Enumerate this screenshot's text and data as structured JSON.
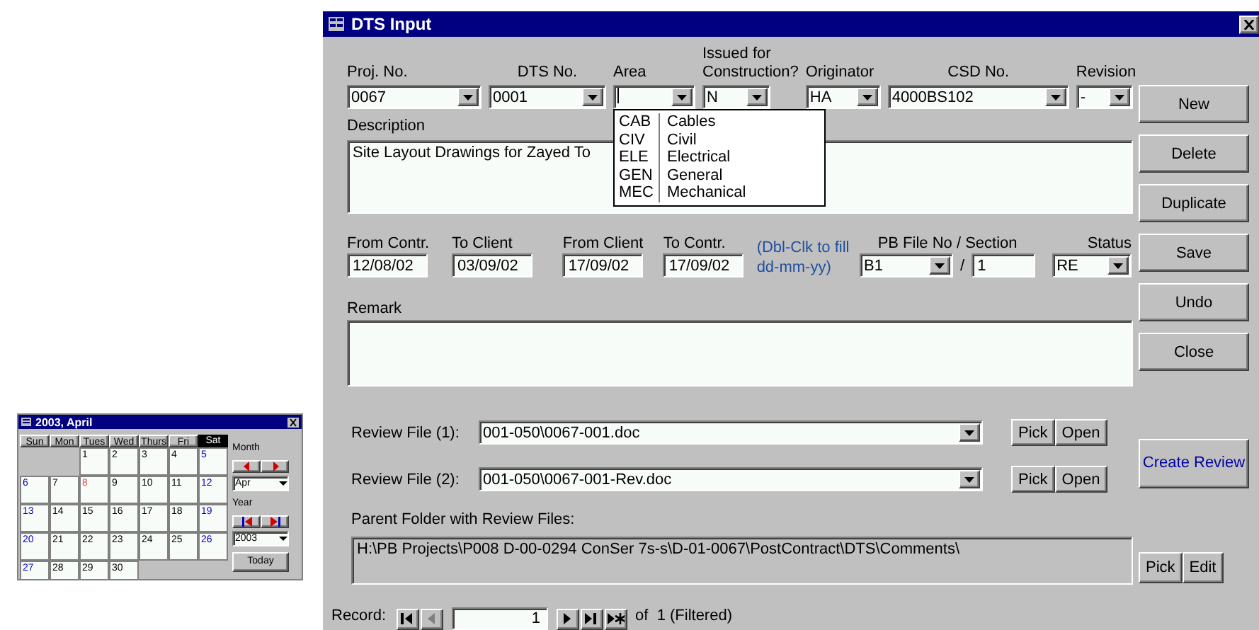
{
  "calendar": {
    "title": "2003, April",
    "days": [
      {
        "label": "Sun",
        "selected": false
      },
      {
        "label": "Mon",
        "selected": false
      },
      {
        "label": "Tues",
        "selected": false
      },
      {
        "label": "Wed",
        "selected": false
      },
      {
        "label": "Thurs",
        "selected": false
      },
      {
        "label": "Fri",
        "selected": false
      },
      {
        "label": "Sat",
        "selected": true
      }
    ],
    "weeks": [
      [
        {
          "kind": "blank"
        },
        {
          "kind": "blank"
        },
        {
          "kind": "weekday",
          "day": "1"
        },
        {
          "kind": "weekday",
          "day": "2"
        },
        {
          "kind": "weekday",
          "day": "3"
        },
        {
          "kind": "weekday",
          "day": "4"
        },
        {
          "kind": "weekend",
          "day": "5"
        }
      ],
      [
        {
          "kind": "weekend",
          "day": "6"
        },
        {
          "kind": "weekday",
          "day": "7"
        },
        {
          "kind": "today",
          "day": "8"
        },
        {
          "kind": "weekday",
          "day": "9"
        },
        {
          "kind": "weekday",
          "day": "10"
        },
        {
          "kind": "weekday",
          "day": "11"
        },
        {
          "kind": "weekend",
          "day": "12"
        }
      ],
      [
        {
          "kind": "weekend",
          "day": "13"
        },
        {
          "kind": "weekday",
          "day": "14"
        },
        {
          "kind": "weekday",
          "day": "15"
        },
        {
          "kind": "weekday",
          "day": "16"
        },
        {
          "kind": "weekday",
          "day": "17"
        },
        {
          "kind": "weekday",
          "day": "18"
        },
        {
          "kind": "weekend",
          "day": "19"
        }
      ],
      [
        {
          "kind": "weekend",
          "day": "20"
        },
        {
          "kind": "weekday",
          "day": "21"
        },
        {
          "kind": "weekday",
          "day": "22"
        },
        {
          "kind": "weekday",
          "day": "23"
        },
        {
          "kind": "weekday",
          "day": "24"
        },
        {
          "kind": "weekday",
          "day": "25"
        },
        {
          "kind": "weekend",
          "day": "26"
        }
      ],
      [
        {
          "kind": "weekend",
          "day": "27"
        },
        {
          "kind": "weekday",
          "day": "28"
        },
        {
          "kind": "weekday",
          "day": "29"
        },
        {
          "kind": "weekday",
          "day": "30"
        },
        {
          "kind": "blank"
        },
        {
          "kind": "blank"
        },
        {
          "kind": "blank"
        }
      ]
    ],
    "month_label": "Month",
    "month": "Apr",
    "year_label": "Year",
    "year": "2003",
    "today_button": "Today"
  },
  "window": {
    "title": "DTS Input"
  },
  "top_fields": [
    {
      "label": "Proj. No.",
      "value": "0067",
      "focused": false
    },
    {
      "label": "DTS No.",
      "value": "0001",
      "focused": false
    },
    {
      "label": "Area",
      "focused": true
    },
    {
      "label": "Issued for Construction?",
      "value": "N",
      "focused": false
    },
    {
      "label": "Originator",
      "value": "HA",
      "focused": false
    },
    {
      "label": "CSD No.",
      "value": "4000BS102",
      "focused": false
    },
    {
      "label": "Revision",
      "value": "-",
      "focused": false
    }
  ],
  "area_dropdown": [
    {
      "code": "CAB",
      "name": "Cables"
    },
    {
      "code": "CIV",
      "name": "Civil"
    },
    {
      "code": "ELE",
      "name": "Electrical"
    },
    {
      "code": "GEN",
      "name": "General"
    },
    {
      "code": "MEC",
      "name": "Mechanical"
    }
  ],
  "description": {
    "label": "Description",
    "value": "Site Layout Drawings for Zayed To"
  },
  "dates": [
    {
      "label": "From Contr.",
      "value": "12/08/02"
    },
    {
      "label": "To Client",
      "value": "03/09/02"
    },
    {
      "label": "From Client",
      "value": "17/09/02"
    },
    {
      "label": "To Contr.",
      "value": "17/09/02"
    }
  ],
  "date_hint": "(Dbl-Clk to fill dd-mm-yy)",
  "pb_file": {
    "label": "PB File No / Section",
    "file": "B1",
    "separator": "/",
    "section": "1"
  },
  "status": {
    "label": "Status",
    "value": "RE"
  },
  "remark": {
    "label": "Remark"
  },
  "review_files": [
    {
      "label": "Review File (1):",
      "value": "001-050\\0067-001.doc",
      "buttons": [
        "Pick",
        "Open"
      ]
    },
    {
      "label": "Review File (2):",
      "value": "001-050\\0067-001-Rev.doc",
      "buttons": [
        "Pick",
        "Open"
      ]
    }
  ],
  "parent_folder": {
    "label": "Parent Folder with Review Files:",
    "value": "H:\\PB Projects\\P008 D-00-0294 ConSer 7s-s\\D-01-0067\\PostContract\\DTS\\Comments\\",
    "buttons": [
      "Pick",
      "Edit"
    ]
  },
  "side_buttons": [
    "New",
    "Delete",
    "Duplicate",
    "Save",
    "Undo",
    "Close"
  ],
  "create_review": "Create Review",
  "record_nav": {
    "label": "Record:",
    "value": "1",
    "total": "of  1 (Filtered)",
    "buttons": [
      {
        "kind": "first",
        "disabled": false
      },
      {
        "kind": "prev",
        "disabled": true
      },
      {
        "kind": "next",
        "disabled": false
      },
      {
        "kind": "last",
        "disabled": false
      },
      {
        "kind": "new",
        "disabled": false
      }
    ]
  }
}
